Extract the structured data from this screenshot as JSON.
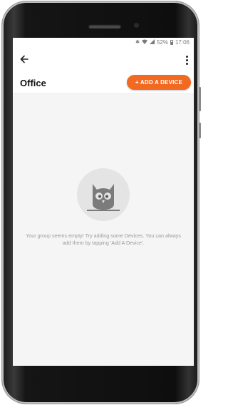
{
  "status_bar": {
    "icons": [
      "bluetooth-icon",
      "wifi-icon",
      "signal-icon",
      "battery-icon"
    ],
    "battery": "52%",
    "time": "17:06"
  },
  "app_bar": {
    "back_icon": "arrow-left-icon",
    "title": "Office",
    "add_button_label": "+ ADD A DEVICE",
    "menu_icon": "more-vertical-icon"
  },
  "empty_state": {
    "illustration": "owl-icon",
    "message": "Your group seems empty! Try adding some Devices. You can always add them by tapping 'Add A Device'."
  },
  "colors": {
    "accent": "#f26a21",
    "screen_bg": "#f5f5f5",
    "placeholder_circle": "#e4e4e4",
    "owl": "#7b7b7b"
  }
}
